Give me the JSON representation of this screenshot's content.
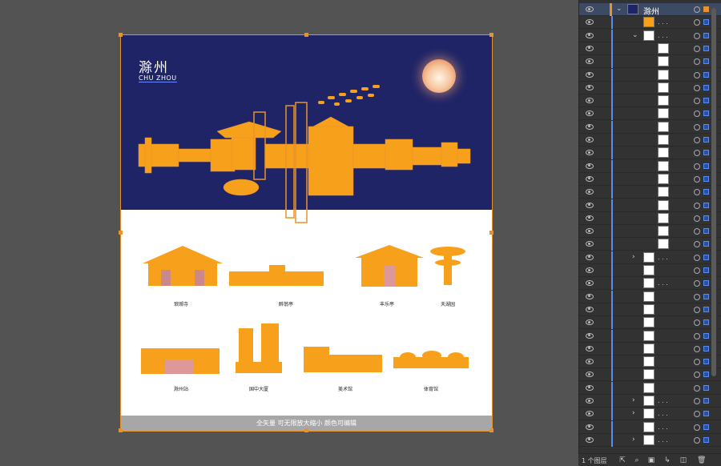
{
  "artboard": {
    "title": "滁州",
    "subtitle": "CHU ZHOU",
    "footer_text": "全矢量 可无限放大缩小 颜色可编辑",
    "buildings_row1": [
      "琅琊寺",
      "醉翁亭",
      "丰乐亭",
      "天湖园"
    ],
    "buildings_row2": [
      "滁州站",
      "国中大厦",
      "美术馆",
      "体育馆"
    ]
  },
  "colors": {
    "accent": "#e8932a",
    "sky": "#1f2466",
    "building": "#f7a01c"
  },
  "layers_panel": {
    "top_layer_name": "滁州",
    "sub_dots": ". . .",
    "layer_count": "1 个图层"
  }
}
